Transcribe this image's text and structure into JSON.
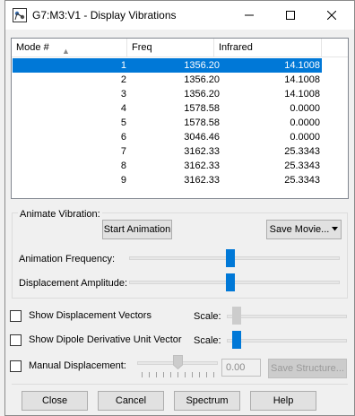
{
  "window": {
    "title": "G7:M3:V1 - Display Vibrations"
  },
  "list": {
    "columns": [
      "Mode #",
      "Freq",
      "Infrared"
    ],
    "rows": [
      {
        "mode": "1",
        "freq": "1356.20",
        "ir": "14.1008",
        "selected": true
      },
      {
        "mode": "2",
        "freq": "1356.20",
        "ir": "14.1008"
      },
      {
        "mode": "3",
        "freq": "1356.20",
        "ir": "14.1008"
      },
      {
        "mode": "4",
        "freq": "1578.58",
        "ir": "0.0000"
      },
      {
        "mode": "5",
        "freq": "1578.58",
        "ir": "0.0000"
      },
      {
        "mode": "6",
        "freq": "3046.46",
        "ir": "0.0000"
      },
      {
        "mode": "7",
        "freq": "3162.33",
        "ir": "25.3343"
      },
      {
        "mode": "8",
        "freq": "3162.33",
        "ir": "25.3343"
      },
      {
        "mode": "9",
        "freq": "3162.33",
        "ir": "25.3343"
      }
    ]
  },
  "animate": {
    "group_label": "Animate Vibration:",
    "start_button": "Start Animation",
    "save_movie_button": "Save Movie...",
    "frequency_label": "Animation Frequency:",
    "frequency_level": 0.48,
    "amplitude_label": "Displacement Amplitude:",
    "amplitude_level": 0.48
  },
  "options": {
    "show_vectors_label": "Show Displacement Vectors",
    "show_vectors_checked": false,
    "vectors_scale_label": "Scale:",
    "vectors_scale_level": 0.05,
    "show_dipole_label": "Show Dipole Derivative Unit Vector",
    "show_dipole_checked": false,
    "dipole_scale_label": "Scale:",
    "dipole_scale_level": 0.05,
    "manual_label": "Manual Displacement:",
    "manual_checked": false,
    "manual_value": "0.00",
    "manual_level": 0.5,
    "save_structure_button": "Save Structure..."
  },
  "footer": {
    "close": "Close",
    "cancel": "Cancel",
    "spectrum": "Spectrum",
    "help": "Help"
  }
}
